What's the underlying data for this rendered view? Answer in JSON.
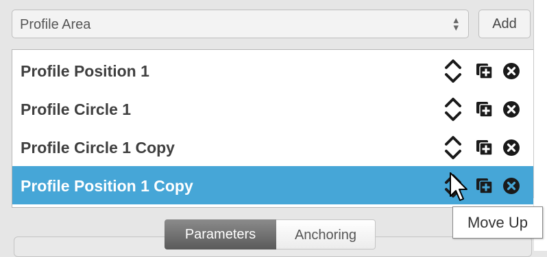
{
  "profile_select": {
    "value": "Profile Area"
  },
  "add_button": {
    "label": "Add"
  },
  "profiles": [
    {
      "label": "Profile Position 1",
      "selected": false
    },
    {
      "label": "Profile Circle 1",
      "selected": false
    },
    {
      "label": "Profile Circle 1 Copy",
      "selected": false
    },
    {
      "label": "Profile Position 1 Copy",
      "selected": true
    }
  ],
  "row_icons": [
    "up-down-arrows-icon",
    "duplicate-icon",
    "delete-circle-icon"
  ],
  "tabs": [
    {
      "label": "Parameters",
      "active": true
    },
    {
      "label": "Anchoring",
      "active": false
    }
  ],
  "tooltip": {
    "text": "Move Up"
  },
  "colors": {
    "selected_row": "#46a6d7",
    "row_text": "#3f3f3f",
    "icon": "#1a1a1a"
  }
}
